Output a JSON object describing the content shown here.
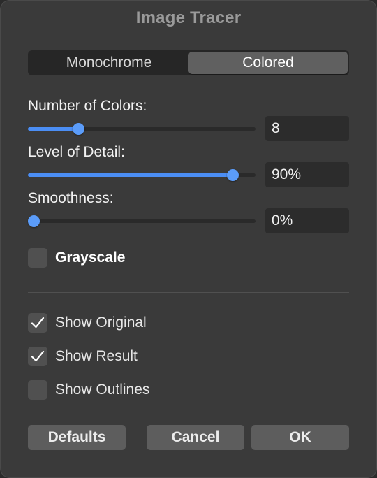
{
  "dialog": {
    "title": "Image Tracer"
  },
  "mode_toggle": {
    "options": [
      "Monochrome",
      "Colored"
    ],
    "selected": "Colored"
  },
  "sliders": [
    {
      "label": "Number of Colors:",
      "value_text": "8",
      "level": 0.22
    },
    {
      "label": "Level of Detail:",
      "value_text": "90%",
      "level": 0.9
    },
    {
      "label": "Smoothness:",
      "value_text": "0%",
      "level": 0.0
    }
  ],
  "grayscale": {
    "label": "Grayscale",
    "checked": false
  },
  "view_options": [
    {
      "label": "Show Original",
      "checked": true
    },
    {
      "label": "Show Result",
      "checked": true
    },
    {
      "label": "Show Outlines",
      "checked": false
    }
  ],
  "buttons": {
    "defaults": "Defaults",
    "cancel": "Cancel",
    "ok": "OK"
  },
  "colors": {
    "accent": "#4b8ef5",
    "panel": "#3a3a3a",
    "field": "#2c2c2c"
  }
}
